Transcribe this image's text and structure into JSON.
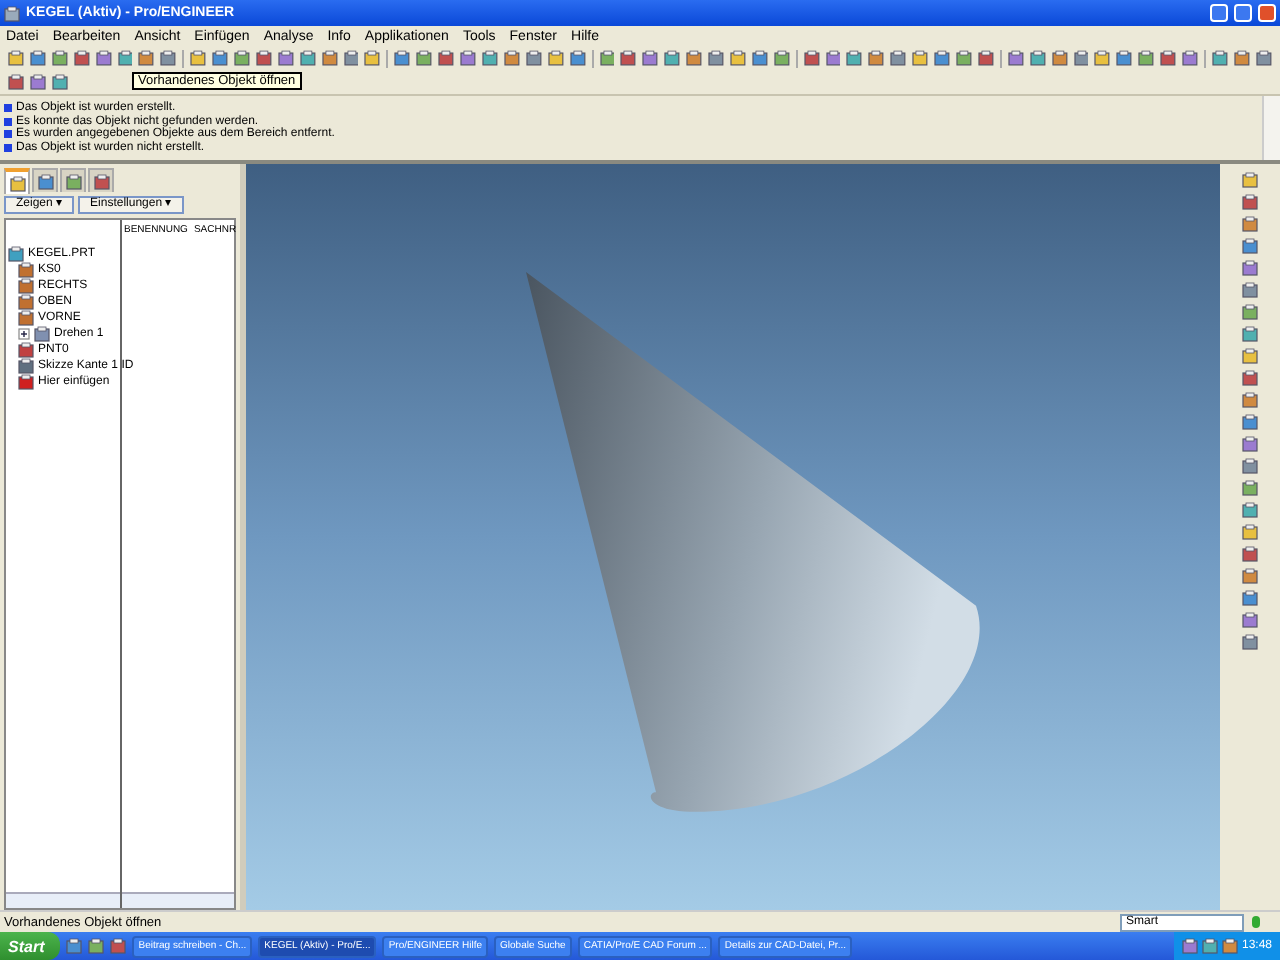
{
  "window": {
    "title": "KEGEL (Aktiv) - Pro/ENGINEER"
  },
  "menu": [
    "Datei",
    "Bearbeiten",
    "Ansicht",
    "Einfügen",
    "Analyse",
    "Info",
    "Applikationen",
    "Tools",
    "Fenster",
    "Hilfe"
  ],
  "tooltip": "Vorhandenes Objekt öffnen",
  "messages": [
    "Das Objekt ist wurden erstellt.",
    "Es konnte das Objekt nicht gefunden werden.",
    "Es wurden angegebenen Objekte aus dem Bereich entfernt.",
    "Das Objekt ist wurden nicht erstellt."
  ],
  "navigator": {
    "tabs": [
      {
        "selected": true
      },
      {
        "selected": false
      },
      {
        "selected": false
      },
      {
        "selected": false
      }
    ],
    "buttons": [
      "Zeigen ▾",
      "Einstellungen ▾"
    ],
    "columns": [
      "BENENNUNG",
      "SACHNR"
    ],
    "tree": [
      {
        "label": "KEGEL.PRT",
        "kind": "part",
        "children": [
          {
            "label": "KS0",
            "kind": "csys"
          },
          {
            "label": "RECHTS",
            "kind": "plane"
          },
          {
            "label": "OBEN",
            "kind": "plane"
          },
          {
            "label": "VORNE",
            "kind": "plane"
          },
          {
            "label": "Drehen 1",
            "kind": "feature",
            "expanded": false
          },
          {
            "label": "PNT0",
            "kind": "point"
          },
          {
            "label": "Skizze Kante 1 ID",
            "kind": "sketch"
          },
          {
            "label": "Hier einfügen",
            "kind": "insert"
          }
        ]
      }
    ]
  },
  "status_bar": {
    "message": "Vorhandenes Objekt öffnen",
    "filter": "Smart"
  },
  "taskbar": {
    "start": "Start",
    "items": [
      {
        "label": "Beitrag schreiben - Ch...",
        "selected": false
      },
      {
        "label": "KEGEL (Aktiv) - Pro/E...",
        "selected": true
      },
      {
        "label": "Pro/ENGINEER Hilfe",
        "selected": false
      },
      {
        "label": "Globale Suche",
        "selected": false
      },
      {
        "label": "CATIA/Pro/E CAD Forum ...",
        "selected": false
      },
      {
        "label": "Details zur CAD-Datei, Pr...",
        "selected": false
      }
    ],
    "clock": "13:48"
  }
}
